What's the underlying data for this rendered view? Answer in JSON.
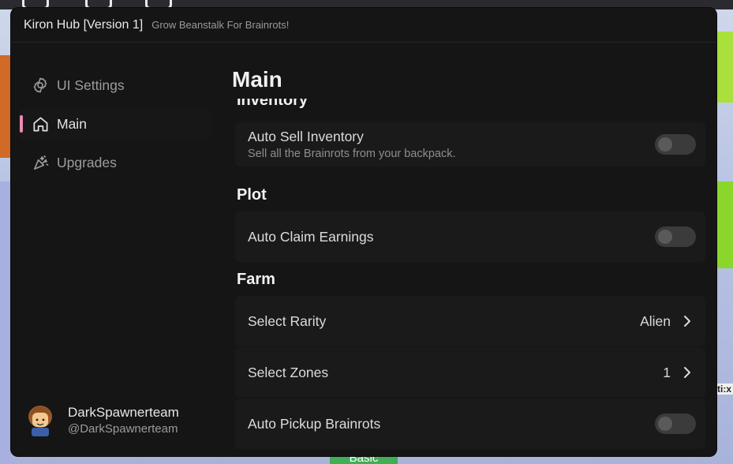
{
  "window": {
    "title": "Kiron Hub [Version 1]",
    "subtitle": "Grow Beanstalk For Brainrots!"
  },
  "sidebar": {
    "items": [
      {
        "label": "UI Settings",
        "icon": "gear-icon",
        "active": false
      },
      {
        "label": "Main",
        "icon": "home-icon",
        "active": true
      },
      {
        "label": "Upgrades",
        "icon": "sparkle-icon",
        "active": false
      }
    ],
    "accent": "#e98bb4"
  },
  "profile": {
    "name": "DarkSpawnerteam",
    "handle": "@DarkSpawnerteam"
  },
  "main": {
    "title": "Main",
    "sections": {
      "inventory": {
        "header": "Inventory",
        "auto_sell": {
          "title": "Auto Sell Inventory",
          "desc": "Sell all the Brainrots from your backpack.",
          "enabled": false
        }
      },
      "plot": {
        "header": "Plot",
        "auto_claim": {
          "title": "Auto Claim Earnings",
          "enabled": false
        }
      },
      "farm": {
        "header": "Farm",
        "select_rarity": {
          "title": "Select Rarity",
          "value": "Alien"
        },
        "select_zones": {
          "title": "Select Zones",
          "value": "1"
        },
        "auto_pickup": {
          "title": "Auto Pickup Brainrots",
          "enabled": false
        }
      }
    }
  },
  "background": {
    "bottom_label": "Basic",
    "right_text": "ti:x"
  },
  "colors": {
    "window_bg": "#151515",
    "card_bg": "#1a1a1a",
    "toggle_off": "#3b3b3b"
  }
}
